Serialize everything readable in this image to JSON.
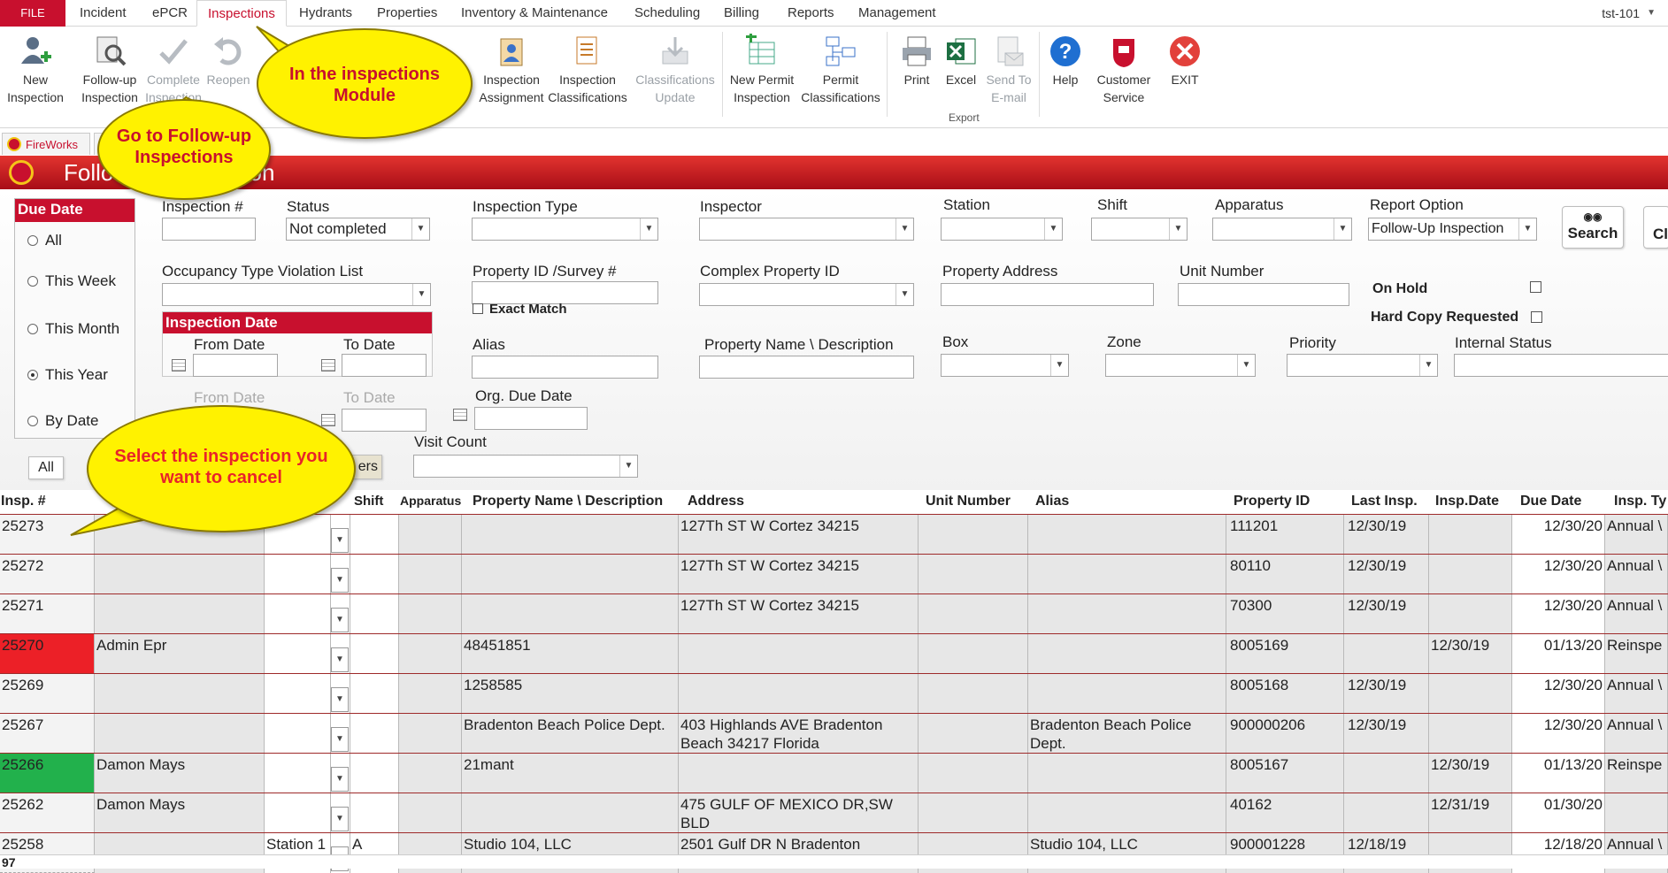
{
  "ribbon_tabs": {
    "file": "FILE",
    "incident": "Incident",
    "epcr": "ePCR",
    "inspections": "Inspections",
    "hydrants": "Hydrants",
    "properties": "Properties",
    "inventory": "Inventory & Maintenance",
    "scheduling": "Scheduling",
    "billing": "Billing",
    "reports": "Reports",
    "management": "Management",
    "user": "tst-101"
  },
  "ribbon": {
    "new_inspection": [
      "New",
      "Inspection"
    ],
    "followup": [
      "Follow-up",
      "Inspection"
    ],
    "complete": [
      "Complete",
      "Inspection"
    ],
    "reopen": [
      "Reopen",
      ""
    ],
    "assignment": [
      "Inspection",
      "Assignment"
    ],
    "classifications": [
      "Inspection",
      "Classifications"
    ],
    "class_update": [
      "Classifications",
      "Update"
    ],
    "new_permit": [
      "New Permit",
      "Inspection"
    ],
    "permit_class": [
      "Permit",
      "Classifications"
    ],
    "print": "Print",
    "excel": "Excel",
    "send_to": [
      "Send To",
      "E-mail"
    ],
    "export_group": "Export",
    "help": "Help",
    "customer_service": [
      "Customer",
      "Service"
    ],
    "exit": "EXIT"
  },
  "doc_tabs": {
    "fireworks": "FireWorks"
  },
  "page_title": "Follow-up Inspection",
  "filters": {
    "due_date_header": "Due Date",
    "due_options": [
      "All",
      "This Week",
      "This Month",
      "This Year",
      "By Date"
    ],
    "due_selected": "This Year",
    "inspection_num_label": "Inspection #",
    "status_label": "Status",
    "status_value": "Not completed",
    "inspection_type_label": "Inspection Type",
    "inspector_label": "Inspector",
    "station_label": "Station",
    "shift_label": "Shift",
    "apparatus_label": "Apparatus",
    "report_option_label": "Report Option",
    "report_option_value": "Follow-Up Inspection",
    "search_button": "Search",
    "clear_button": "Cl",
    "occupancy_label": "Occupancy Type Violation List",
    "property_id_label": "Property ID /Survey #",
    "exact_match_label": "Exact Match",
    "complex_label": "Complex Property ID",
    "address_label": "Property Address",
    "unit_label": "Unit Number",
    "on_hold_label": "On Hold",
    "hard_copy_label": "Hard Copy Requested",
    "insp_date_header": "Inspection Date",
    "from_date": "From Date",
    "to_date": "To Date",
    "alias_label": "Alias",
    "prop_name_label": "Property Name \\ Description",
    "box_label": "Box",
    "zone_label": "Zone",
    "priority_label": "Priority",
    "internal_status_label": "Internal Status",
    "from_date2": "From Date",
    "to_date2": "To Date",
    "org_due_label": "Org. Due Date",
    "visit_count_label": "Visit Count",
    "all_button": "All",
    "filters_button_fragment": "ers"
  },
  "grid": {
    "headers": [
      "Insp. #",
      "Shift",
      "Apparatus",
      "Property Name \\ Description",
      "Address",
      "Unit Number",
      "Alias",
      "Property ID",
      "Last Insp.",
      "Insp.Date",
      "Due Date",
      "Insp. Ty"
    ],
    "rows": [
      {
        "id": "25273",
        "inspector": "",
        "station": "",
        "shift": "",
        "apparatus": "",
        "prop": "",
        "address": "127Th ST W Cortez 34215",
        "unit": "",
        "alias": "",
        "pid": "111201",
        "last": "12/30/19",
        "idate": "",
        "due": "12/30/20",
        "type": "Annual \\",
        "hl": ""
      },
      {
        "id": "25272",
        "inspector": "",
        "station": "",
        "shift": "",
        "apparatus": "",
        "prop": "",
        "address": "127Th ST W Cortez 34215",
        "unit": "",
        "alias": "",
        "pid": "80110",
        "last": "12/30/19",
        "idate": "",
        "due": "12/30/20",
        "type": "Annual \\",
        "hl": ""
      },
      {
        "id": "25271",
        "inspector": "",
        "station": "",
        "shift": "",
        "apparatus": "",
        "prop": "",
        "address": "127Th ST W Cortez 34215",
        "unit": "",
        "alias": "",
        "pid": "70300",
        "last": "12/30/19",
        "idate": "",
        "due": "12/30/20",
        "type": "Annual \\",
        "hl": ""
      },
      {
        "id": "25270",
        "inspector": "Admin Epr",
        "station": "",
        "shift": "",
        "apparatus": "",
        "prop": "48451851",
        "address": "",
        "unit": "",
        "alias": "",
        "pid": "8005169",
        "last": "",
        "idate": "12/30/19",
        "due": "01/13/20",
        "type": "Reinspe",
        "hl": "red"
      },
      {
        "id": "25269",
        "inspector": "",
        "station": "",
        "shift": "",
        "apparatus": "",
        "prop": "1258585",
        "address": "",
        "unit": "",
        "alias": "",
        "pid": "8005168",
        "last": "12/30/19",
        "idate": "",
        "due": "12/30/20",
        "type": "Annual \\",
        "hl": ""
      },
      {
        "id": "25267",
        "inspector": "",
        "station": "",
        "shift": "",
        "apparatus": "",
        "prop": "Bradenton Beach Police Dept.",
        "address": "403 Highlands AVE  Bradenton Beach 34217 Florida",
        "unit": "",
        "alias": "Bradenton Beach Police Dept.",
        "pid": "900000206",
        "last": "12/30/19",
        "idate": "",
        "due": "12/30/20",
        "type": "Annual \\",
        "hl": ""
      },
      {
        "id": "25266",
        "inspector": "Damon Mays",
        "station": "",
        "shift": "",
        "apparatus": "",
        "prop": "21mant",
        "address": "",
        "unit": "",
        "alias": "",
        "pid": "8005167",
        "last": "",
        "idate": "12/30/19",
        "due": "01/13/20",
        "type": "Reinspe",
        "hl": "green"
      },
      {
        "id": "25262",
        "inspector": "Damon Mays",
        "station": "",
        "shift": "",
        "apparatus": "",
        "prop": "",
        "address": "475 GULF OF MEXICO DR,SW BLD",
        "unit": "",
        "alias": "",
        "pid": "40162",
        "last": "",
        "idate": "12/31/19",
        "due": "01/30/20",
        "type": "",
        "hl": ""
      },
      {
        "id": "25258",
        "inspector": "",
        "station": "Station 1",
        "shift": "A",
        "apparatus": "",
        "prop": "Studio 104, LLC",
        "address": "2501 Gulf DR N Bradenton",
        "unit": "",
        "alias": "Studio 104, LLC",
        "pid": "900001228",
        "last": "12/18/19",
        "idate": "",
        "due": "12/18/20",
        "type": "Annual \\",
        "hl": ""
      }
    ],
    "record_count": "97"
  },
  "callouts": {
    "module": "In the inspections Module",
    "followup": "Go to Follow-up Inspections",
    "select": "Select the inspection you want to cancel"
  },
  "colors": {
    "brand_red": "#c8102e",
    "callout_yellow": "#fff200",
    "row_red": "#ec2027",
    "row_green": "#22b14c"
  }
}
